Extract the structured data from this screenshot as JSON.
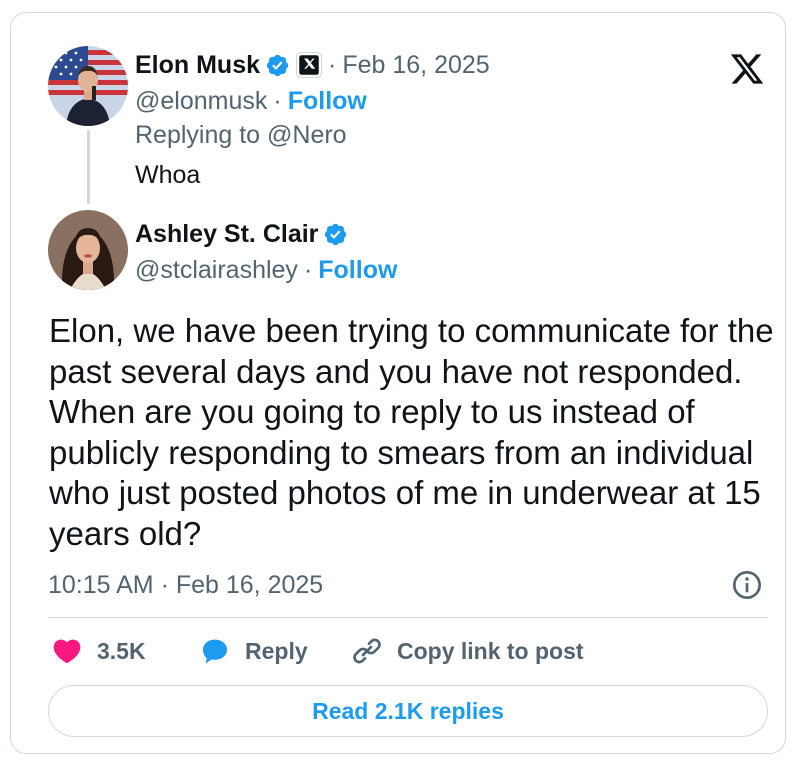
{
  "parent_tweet": {
    "author_name": "Elon Musk",
    "date": "Feb 16, 2025",
    "handle": "@elonmusk",
    "follow_label": "Follow",
    "replying_to": "Replying to @Nero",
    "text": "Whoa",
    "verified_icon": "verified-badge-icon",
    "affiliate_icon": "x-affiliate-icon"
  },
  "main_tweet": {
    "author_name": "Ashley St. Clair",
    "handle": "@stclairashley",
    "follow_label": "Follow",
    "text": "Elon, we have been trying to communicate for the past several days and you have not responded. When are you going to reply to us instead of publicly responding to smears from an individual who just posted photos of me in underwear at 15 years old?",
    "timestamp": "10:15 AM · Feb 16, 2025",
    "verified_icon": "verified-badge-icon"
  },
  "actions": {
    "like_count": "3.5K",
    "reply_label": "Reply",
    "copy_label": "Copy link to post"
  },
  "read_replies_label": "Read 2.1K replies",
  "separator": "·",
  "colors": {
    "accent": "#1d9bf0",
    "like": "#f91880",
    "muted": "#536471",
    "text": "#0f1419",
    "border": "#cfd9de"
  },
  "icons": [
    "x-logo-icon",
    "verified-badge-icon",
    "x-affiliate-icon",
    "info-icon",
    "heart-icon",
    "reply-bubble-icon",
    "link-icon"
  ]
}
